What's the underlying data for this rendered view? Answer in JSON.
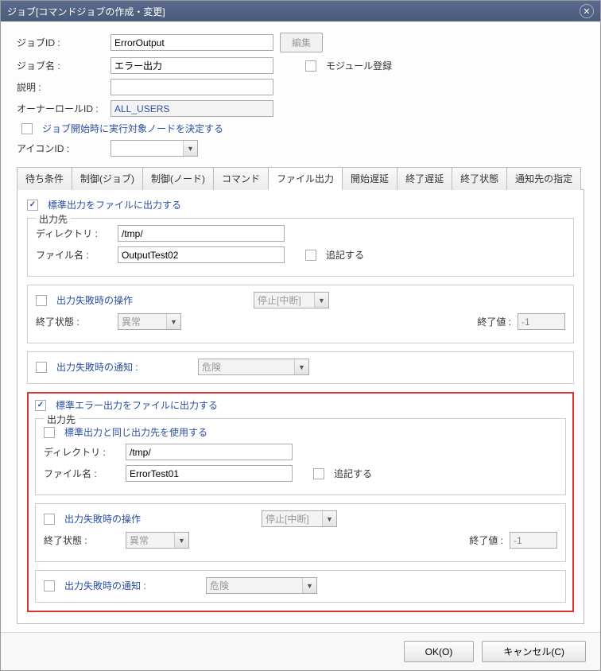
{
  "title": "ジョブ[コマンドジョブの作成・変更]",
  "header": {
    "jobIdLabel": "ジョブID :",
    "jobId": "ErrorOutput",
    "editBtn": "編集",
    "jobNameLabel": "ジョブ名 :",
    "jobName": "エラー出力",
    "moduleReg": "モジュール登録",
    "descLabel": "説明 :",
    "desc": "",
    "ownerLabel": "オーナーロールID :",
    "owner": "ALL_USERS",
    "decideNode": "ジョブ開始時に実行対象ノードを決定する",
    "iconIdLabel": "アイコンID :",
    "iconId": ""
  },
  "tabs": {
    "t0": "待ち条件",
    "t1": "制御(ジョブ)",
    "t2": "制御(ノード)",
    "t3": "コマンド",
    "t4": "ファイル出力",
    "t5": "開始遅延",
    "t6": "終了遅延",
    "t7": "終了状態",
    "t8": "通知先の指定"
  },
  "stdout": {
    "enable": "標準出力をファイルに出力する",
    "destLegend": "出力先",
    "dirLabel": "ディレクトリ :",
    "dir": "/tmp/",
    "fileLabel": "ファイル名 :",
    "file": "OutputTest02",
    "append": "追記する",
    "onFail": "出力失敗時の操作",
    "stopOpt": "停止[中断]",
    "endStateLabel": "終了状態 :",
    "endState": "異常",
    "endValLabel": "終了値 :",
    "endVal": "-1",
    "notifyFail": "出力失敗時の通知 :",
    "severity": "危険"
  },
  "stderr": {
    "enable": "標準エラー出力をファイルに出力する",
    "destLegend": "出力先",
    "sameAsStdout": "標準出力と同じ出力先を使用する",
    "dirLabel": "ディレクトリ :",
    "dir": "/tmp/",
    "fileLabel": "ファイル名 :",
    "file": "ErrorTest01",
    "append": "追記する",
    "onFail": "出力失敗時の操作",
    "stopOpt": "停止[中断]",
    "endStateLabel": "終了状態 :",
    "endState": "異常",
    "endValLabel": "終了値 :",
    "endVal": "-1",
    "notifyFail": "出力失敗時の通知 :",
    "severity": "危険"
  },
  "footer": {
    "ok": "OK(O)",
    "cancel": "キャンセル(C)"
  }
}
